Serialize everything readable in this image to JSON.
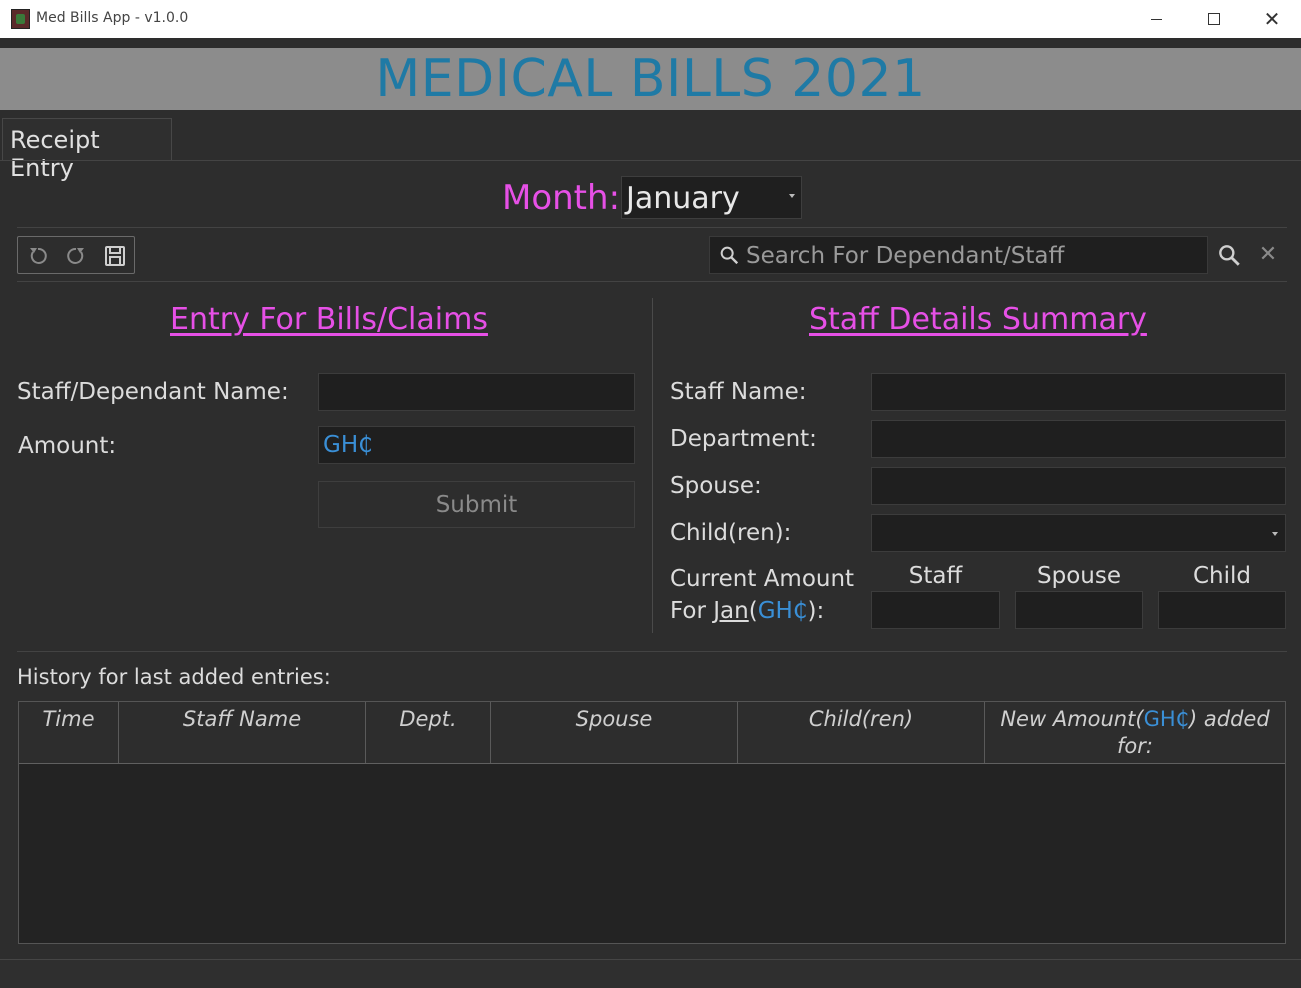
{
  "window": {
    "title": "Med Bills App - v1.0.0"
  },
  "banner": {
    "title": "MEDICAL BILLS 2021"
  },
  "tabs": [
    {
      "label": "Receipt Entry"
    }
  ],
  "month": {
    "label": "Month:",
    "selected": "January"
  },
  "search": {
    "placeholder": "Search For Dependant/Staff"
  },
  "entry": {
    "title": "Entry For Bills/Claims",
    "name_label": "Staff/Dependant Name:",
    "amount_label": "Amount:",
    "amount_value": "GH₵",
    "submit_label": "Submit"
  },
  "summary": {
    "title": "Staff Details Summary",
    "staff_name_label": "Staff Name:",
    "department_label": "Department:",
    "spouse_label": "Spouse:",
    "children_label": "Child(ren):",
    "current_amount_line1": "Current Amount",
    "current_amount_for": "For",
    "current_amount_month": "Jan",
    "current_amount_open": "(",
    "current_amount_currency": "GH₵",
    "current_amount_close": "):",
    "columns": [
      "Staff",
      "Spouse",
      "Child"
    ]
  },
  "history": {
    "label": "History for last added entries:",
    "columns": [
      "Time",
      "Staff Name",
      "Dept.",
      "Spouse",
      "Child(ren)"
    ],
    "last_column": {
      "prefix": "New Amount",
      "open": "(",
      "currency": "GH₵",
      "suffix": ") added for:"
    },
    "rows": []
  },
  "colors": {
    "accent_pink": "#e650e6",
    "accent_blue": "#1f7aa5",
    "currency_blue": "#3a8fd6"
  }
}
